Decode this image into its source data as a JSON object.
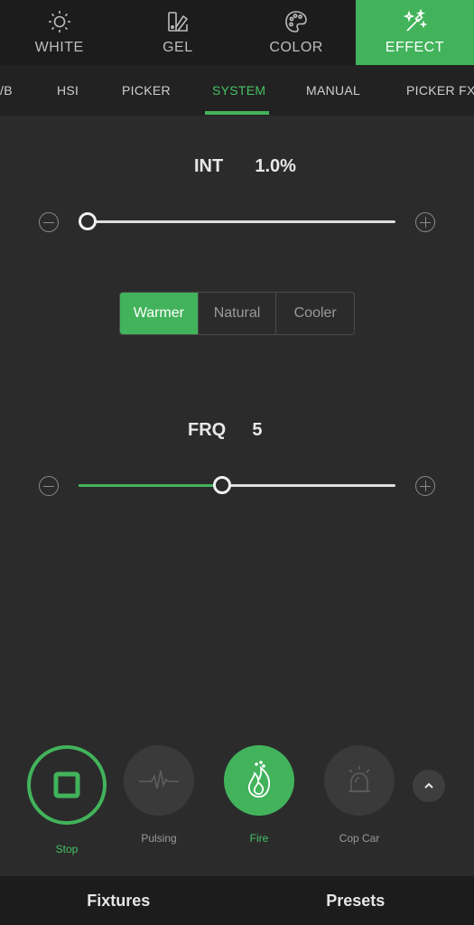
{
  "mode_tabs": [
    {
      "label": "WHITE",
      "icon": "sun-icon",
      "active": false
    },
    {
      "label": "GEL",
      "icon": "gel-swatch-icon",
      "active": false
    },
    {
      "label": "COLOR",
      "icon": "palette-icon",
      "active": false
    },
    {
      "label": "EFFECT",
      "icon": "magic-wand-icon",
      "active": true
    }
  ],
  "sub_tabs": [
    {
      "label": "/B",
      "active": false
    },
    {
      "label": "HSI",
      "active": false
    },
    {
      "label": "PICKER",
      "active": false
    },
    {
      "label": "SYSTEM",
      "active": true
    },
    {
      "label": "MANUAL",
      "active": false
    },
    {
      "label": "PICKER FX",
      "active": false
    }
  ],
  "intensity": {
    "label": "INT",
    "value_text": "1.0%",
    "level": 0.0
  },
  "color_temp_options": [
    {
      "label": "Warmer",
      "active": true
    },
    {
      "label": "Natural",
      "active": false
    },
    {
      "label": "Cooler",
      "active": false
    }
  ],
  "frequency": {
    "label": "FRQ",
    "value_text": "5",
    "level": 0.45
  },
  "effects": [
    {
      "label": "Stop",
      "icon": "stop-square-icon",
      "state": "selected"
    },
    {
      "label": "Pulsing",
      "icon": "pulse-wave-icon",
      "state": "disabled"
    },
    {
      "label": "Fire",
      "icon": "flame-icon",
      "state": "active"
    },
    {
      "label": "Cop Car",
      "icon": "siren-icon",
      "state": "disabled"
    }
  ],
  "bottom_nav": [
    {
      "label": "Fixtures"
    },
    {
      "label": "Presets"
    }
  ],
  "colors": {
    "accent": "#42b35b",
    "background": "#2b2b2b",
    "bar": "#1c1c1c"
  }
}
